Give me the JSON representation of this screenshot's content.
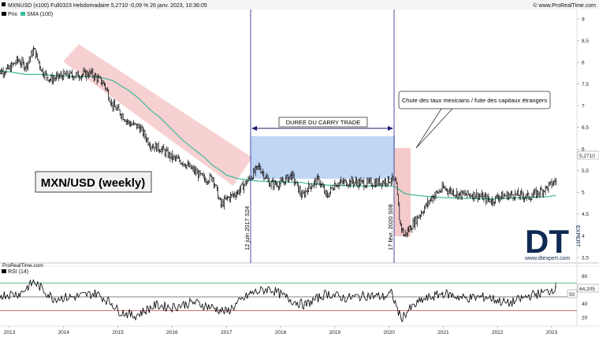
{
  "header": {
    "title_line": "MXNUSD (x100) Full0323 Hebdomadaire 5,2710 -0,09 % 26 janv. 2023, 10:36:05",
    "brand": "© www.ProRealTime.com",
    "legend_price": "Prix",
    "legend_sma": "SMA (100)"
  },
  "main_panel": {
    "label_box": "MXN/USD (weekly)",
    "carry_trade_label": "DUREE DU CARRY TRADE",
    "callout": "Chute des taux mexicains / fuite des capitaux étrangers",
    "vline_1_label": "12 juin 2017 S24",
    "vline_2_label": "17 févr. 2020 S08",
    "source": "ProRealTime.com",
    "last_value": "5,2710"
  },
  "rsi_panel": {
    "label": "RSI (14)",
    "last_value": "64,205",
    "mid_label": "50"
  },
  "logo": {
    "letters": "DT",
    "sub": "EXPERT",
    "url": "www.dtexpert.com"
  },
  "colors": {
    "price": "#000000",
    "sma": "#3cb89a",
    "pink_zone": "#f2b8b8",
    "blue_zone": "#9ec0ef",
    "vline": "#4a4f9c",
    "rsi": "#000000",
    "rsi_upper": "#3aa860",
    "rsi_lower": "#d04050",
    "rsi_mid": "#5a5a5a"
  },
  "chart_data": [
    {
      "type": "line",
      "title": "MXNUSD (x100) Full0323 Hebdomadaire",
      "xlabel": "",
      "ylabel": "",
      "x_ticks": [
        "2013",
        "2014",
        "2015",
        "2016",
        "2017",
        "2018",
        "2019",
        "2020",
        "2021",
        "2022",
        "2023"
      ],
      "y_ticks": [
        9,
        8.5,
        8,
        7.5,
        7,
        6.5,
        6,
        5.5,
        5,
        4.5,
        4,
        3.5
      ],
      "ylim": [
        3.2,
        9.2
      ],
      "x": [
        2012.75,
        2013.0,
        2013.15,
        2013.3,
        2013.45,
        2013.6,
        2013.75,
        2014.0,
        2014.25,
        2014.5,
        2014.75,
        2014.9,
        2015.0,
        2015.2,
        2015.4,
        2015.6,
        2015.8,
        2016.0,
        2016.2,
        2016.4,
        2016.6,
        2016.75,
        2016.9,
        2017.0,
        2017.2,
        2017.45,
        2017.6,
        2017.8,
        2018.0,
        2018.2,
        2018.4,
        2018.5,
        2018.7,
        2018.85,
        2019.0,
        2019.3,
        2019.6,
        2019.9,
        2020.05,
        2020.13,
        2020.2,
        2020.28,
        2020.4,
        2020.6,
        2020.8,
        2021.0,
        2021.3,
        2021.6,
        2021.9,
        2022.0,
        2022.3,
        2022.6,
        2022.9,
        2023.08
      ],
      "series": [
        {
          "name": "Prix",
          "values": [
            7.75,
            7.85,
            8.05,
            7.9,
            8.3,
            7.8,
            7.6,
            7.7,
            7.7,
            7.75,
            7.5,
            7.0,
            6.9,
            6.6,
            6.5,
            6.1,
            6.0,
            5.8,
            5.7,
            5.5,
            5.3,
            5.35,
            4.7,
            4.85,
            5.0,
            5.35,
            5.6,
            5.2,
            5.2,
            5.4,
            4.9,
            5.1,
            5.3,
            4.9,
            5.2,
            5.25,
            5.2,
            5.25,
            5.3,
            5.2,
            4.3,
            4.0,
            4.2,
            4.55,
            4.9,
            5.1,
            4.95,
            4.95,
            4.8,
            4.9,
            4.95,
            4.9,
            5.1,
            5.27
          ]
        },
        {
          "name": "SMA (100)",
          "values": [
            7.8,
            7.78,
            7.75,
            7.72,
            7.72,
            7.72,
            7.7,
            7.68,
            7.67,
            7.67,
            7.63,
            7.58,
            7.5,
            7.35,
            7.15,
            6.9,
            6.7,
            6.45,
            6.2,
            6.0,
            5.8,
            5.62,
            5.5,
            5.4,
            5.32,
            5.28,
            5.26,
            5.25,
            5.24,
            5.23,
            5.23,
            5.2,
            5.19,
            5.17,
            5.16,
            5.15,
            5.15,
            5.15,
            5.15,
            5.12,
            5.05,
            4.98,
            4.95,
            4.92,
            4.9,
            4.88,
            4.87,
            4.86,
            4.85,
            4.86,
            4.87,
            4.88,
            4.9,
            4.93
          ]
        }
      ]
    },
    {
      "type": "line",
      "title": "RSI (14)",
      "y_ticks": [
        80,
        60,
        40,
        20
      ],
      "ylim": [
        10,
        90
      ],
      "hlines": [
        30,
        50,
        70
      ],
      "x": [
        2012.75,
        2013.2,
        2013.45,
        2013.8,
        2014.2,
        2014.6,
        2014.9,
        2015.0,
        2015.3,
        2015.7,
        2016.0,
        2016.4,
        2016.8,
        2017.0,
        2017.45,
        2017.8,
        2018.2,
        2018.45,
        2018.85,
        2019.2,
        2019.6,
        2019.9,
        2020.05,
        2020.22,
        2020.35,
        2020.6,
        2021.0,
        2021.4,
        2021.8,
        2022.2,
        2022.6,
        2022.95,
        2023.08
      ],
      "series": [
        {
          "name": "RSI (14)",
          "values": [
            52,
            55,
            72,
            48,
            50,
            55,
            40,
            30,
            22,
            38,
            35,
            42,
            33,
            28,
            55,
            62,
            45,
            38,
            55,
            48,
            52,
            50,
            55,
            18,
            30,
            45,
            55,
            48,
            50,
            40,
            52,
            58,
            64.2
          ]
        }
      ]
    }
  ]
}
